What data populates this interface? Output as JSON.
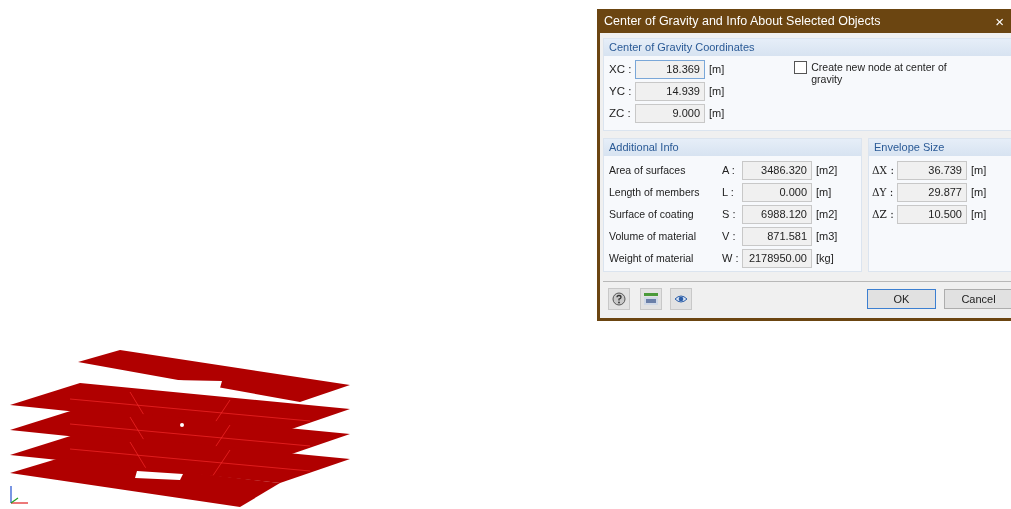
{
  "window": {
    "title": "Center of Gravity and Info About Selected Objects",
    "close": "×"
  },
  "coordinates": {
    "title": "Center of Gravity Coordinates",
    "rows": [
      {
        "label": "XC :",
        "value": "18.369",
        "unit": "[m]",
        "focused": true
      },
      {
        "label": "YC :",
        "value": "14.939",
        "unit": "[m]",
        "focused": false
      },
      {
        "label": "ZC :",
        "value": "9.000",
        "unit": "[m]",
        "focused": false
      }
    ],
    "checkbox": {
      "label": "Create new node at center of gravity",
      "checked": false
    }
  },
  "additional_info": {
    "title": "Additional Info",
    "rows": [
      {
        "label": "Area of surfaces",
        "symbol": "A :",
        "value": "3486.320",
        "unit": "[m2]"
      },
      {
        "label": "Length of members",
        "symbol": "L :",
        "value": "0.000",
        "unit": "[m]"
      },
      {
        "label": "Surface of coating",
        "symbol": "S :",
        "value": "6988.120",
        "unit": "[m2]"
      },
      {
        "label": "Volume of material",
        "symbol": "V :",
        "value": "871.581",
        "unit": "[m3]"
      },
      {
        "label": "Weight of material",
        "symbol": "W :",
        "value": "2178950.00",
        "unit": "[kg]"
      }
    ]
  },
  "envelope_size": {
    "title": "Envelope Size",
    "rows": [
      {
        "label": "ΔX :",
        "value": "36.739",
        "unit": "[m]"
      },
      {
        "label": "ΔY :",
        "value": "29.877",
        "unit": "[m]"
      },
      {
        "label": "ΔZ :",
        "value": "10.500",
        "unit": "[m]"
      }
    ]
  },
  "buttons": [
    {
      "label": "OK",
      "default": true
    },
    {
      "label": "Cancel",
      "default": false
    }
  ]
}
